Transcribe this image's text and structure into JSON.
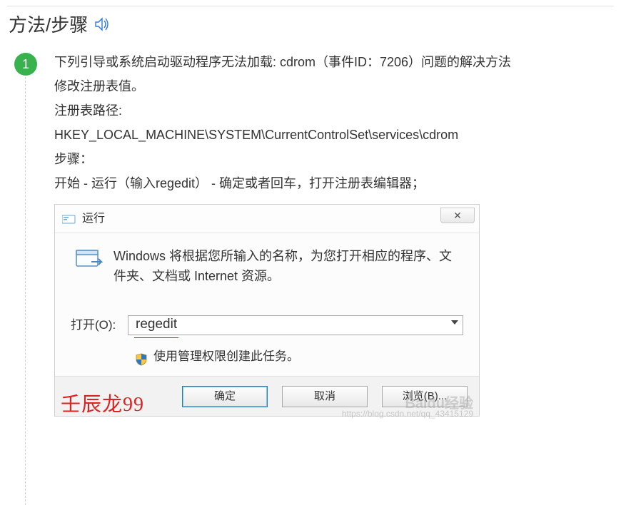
{
  "section_title": "方法/步骤",
  "step": {
    "num": "1",
    "lines": [
      "下列引导或系统启动驱动程序无法加载: cdrom（事件ID：7206）问题的解决方法",
      "修改注册表值。",
      "注册表路径:",
      "HKEY_LOCAL_MACHINE\\SYSTEM\\CurrentControlSet\\services\\cdrom",
      "步骤：",
      "开始 - 运行（输入regedit） - 确定或者回车，打开注册表编辑器；"
    ]
  },
  "dialog": {
    "title": "运行",
    "close_glyph": "✕",
    "description": "Windows 将根据您所输入的名称，为您打开相应的程序、文件夹、文档或 Internet 资源。",
    "open_label": "打开(O):",
    "open_value": "regedit",
    "shield_text": "使用管理权限创建此任务。",
    "buttons": {
      "ok": "确定",
      "cancel": "取消",
      "browse": "浏览(B)..."
    },
    "watermark_left": "壬辰龙99",
    "watermark_baidu": "Baidu经验",
    "watermark_url": "https://blog.csdn.net/qq_43415129"
  }
}
